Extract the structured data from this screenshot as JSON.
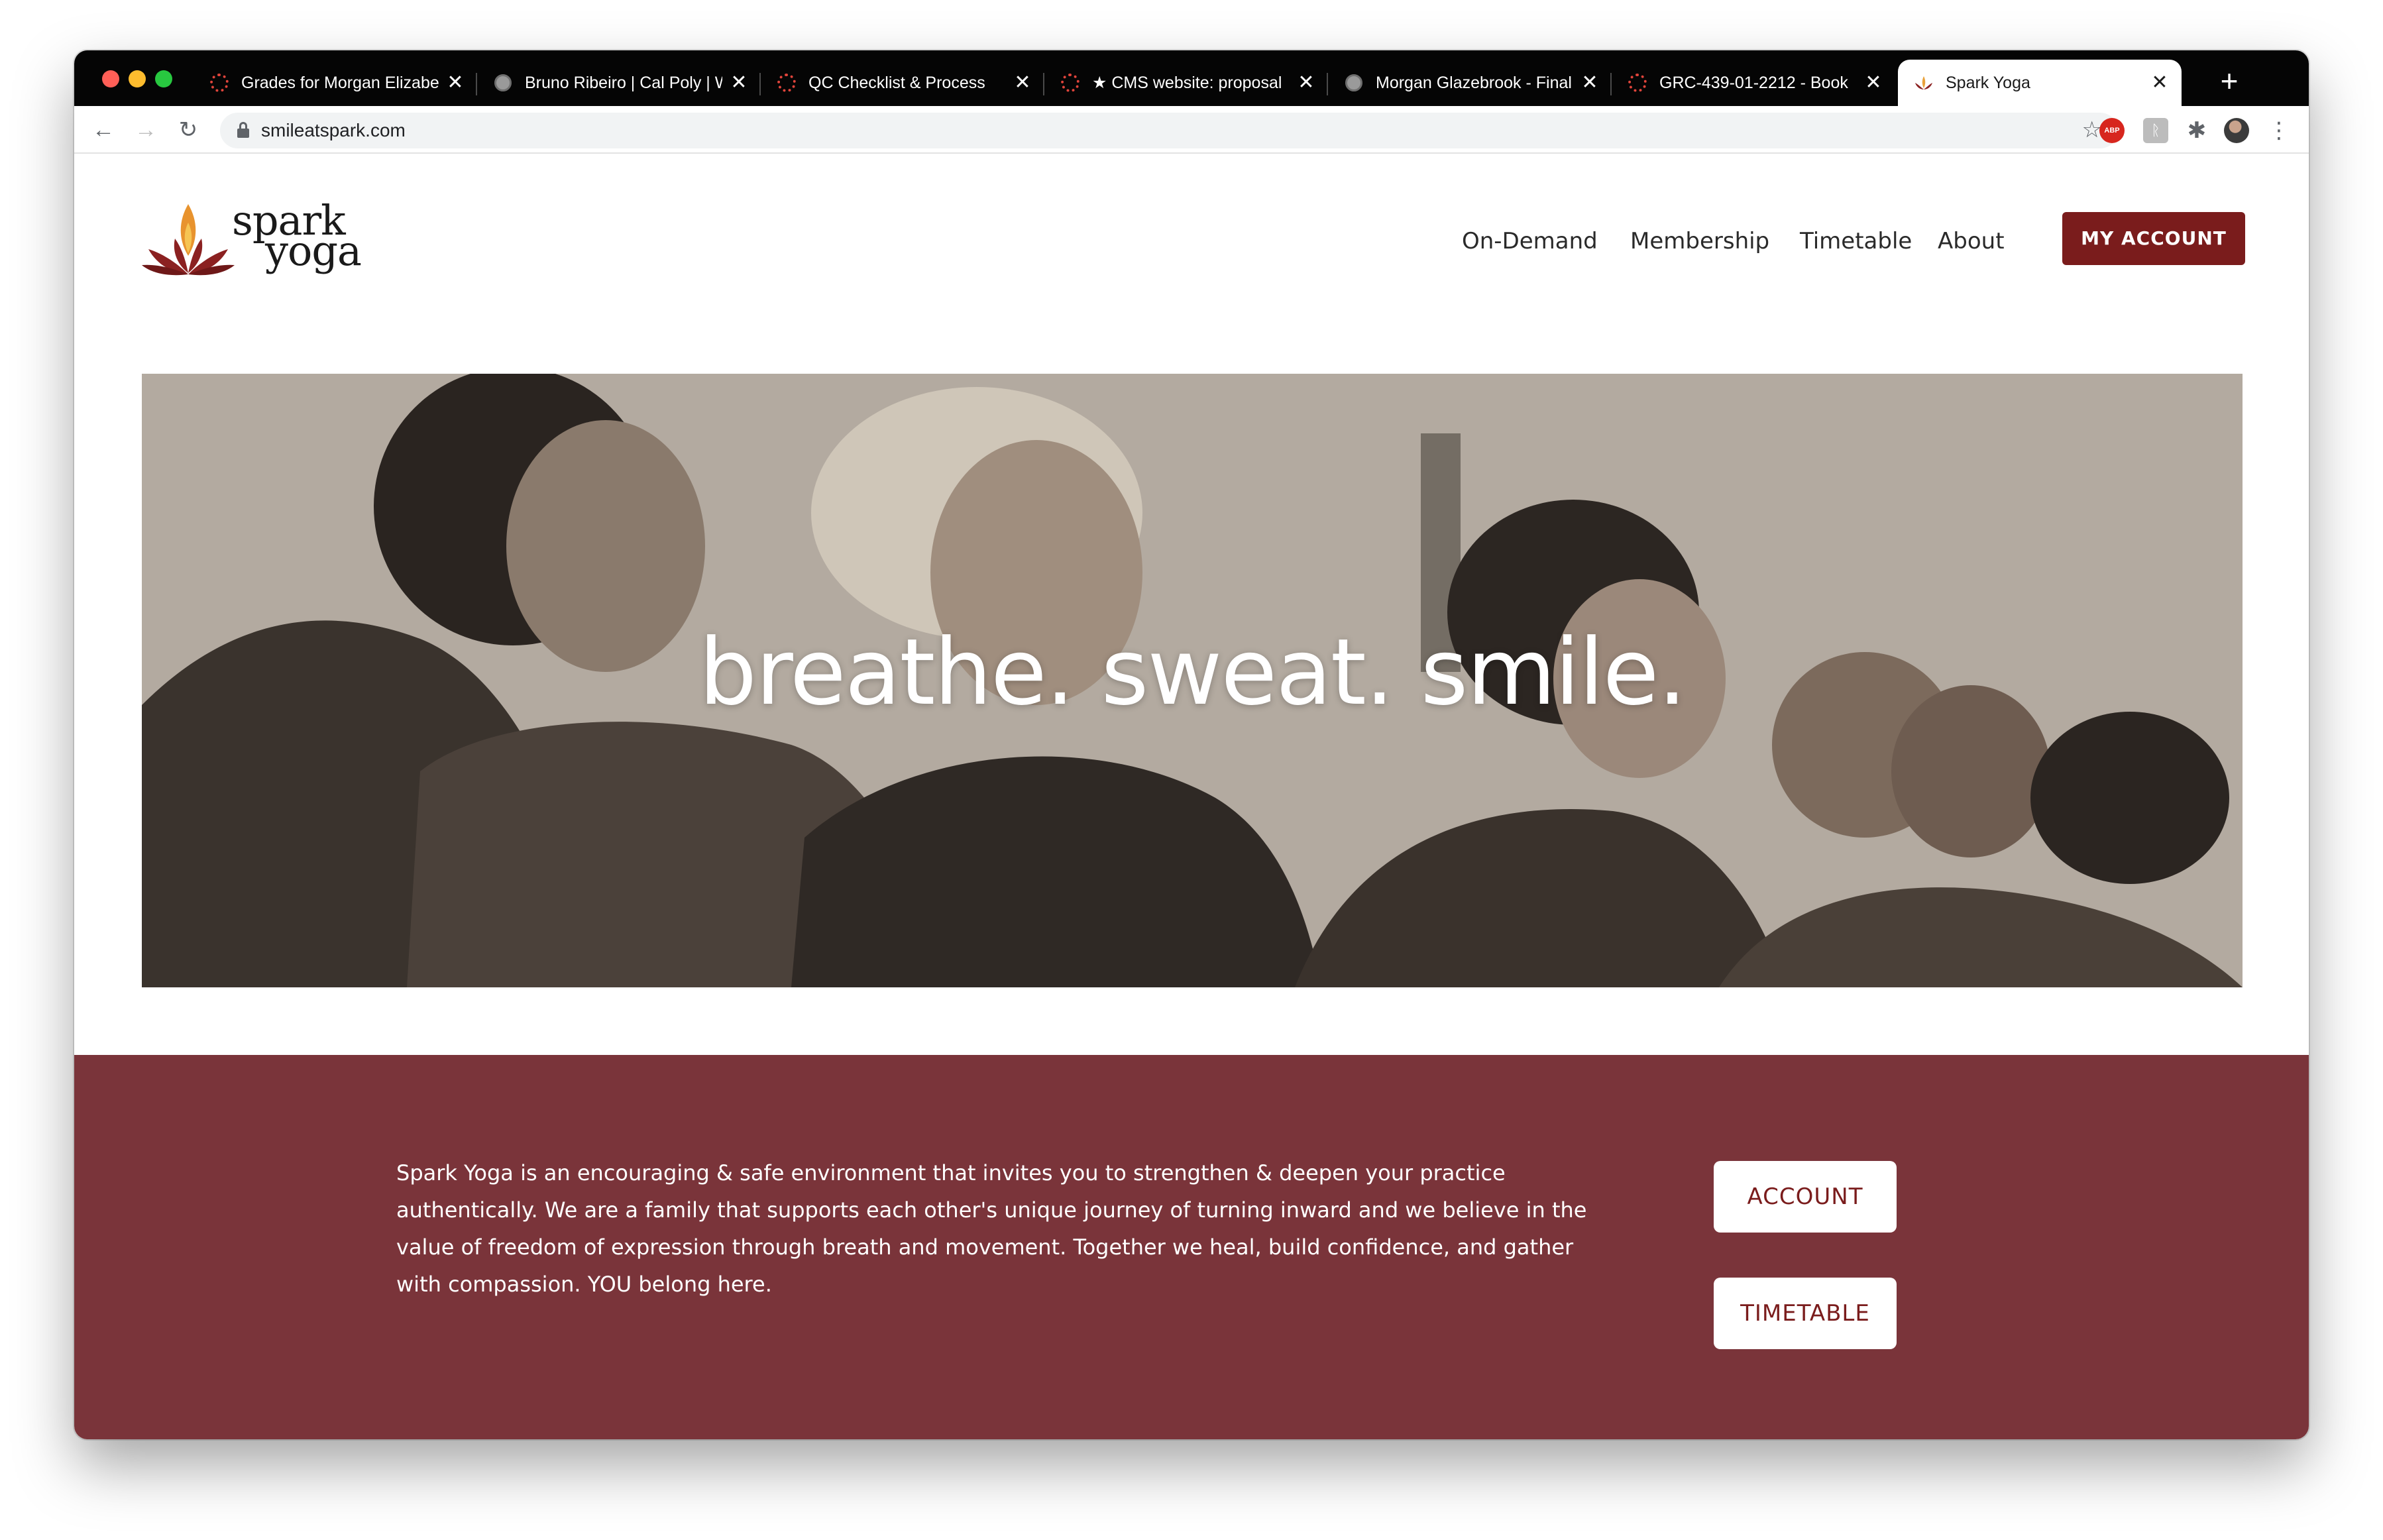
{
  "browser": {
    "tabs": [
      {
        "title": "Grades for Morgan Elizabe",
        "icon": "canvas-icon"
      },
      {
        "title": "Bruno Ribeiro | Cal Poly | W",
        "icon": "globe-icon"
      },
      {
        "title": "QC Checklist & Process",
        "icon": "canvas-icon"
      },
      {
        "title": "★ CMS website: proposal",
        "icon": "canvas-icon"
      },
      {
        "title": "Morgan Glazebrook - Final",
        "icon": "globe-icon"
      },
      {
        "title": "GRC-439-01-2212 - Book",
        "icon": "canvas-icon"
      },
      {
        "title": "Spark Yoga",
        "icon": "spark-lotus-icon",
        "active": true
      }
    ],
    "new_tab_label": "+",
    "close_glyph": "✕",
    "url": "smileatspark.com",
    "extensions": {
      "abp_label": "ABP",
      "ext2_label": "ᚱ"
    }
  },
  "site": {
    "logo": {
      "line1": "spark",
      "line2": "yoga"
    },
    "nav": {
      "on_demand": "On-Demand",
      "membership": "Membership",
      "timetable": "Timetable",
      "about": "About",
      "my_account": "MY ACCOUNT"
    },
    "hero": {
      "tagline": "breathe. sweat. smile."
    },
    "intro": {
      "text": "Spark Yoga is an encouraging & safe environment that invites you to strengthen & deepen your practice authentically. We are a family that supports each other's unique journey of turning inward and we believe in the value of freedom of expression through breath and movement. Together we heal, build confidence, and gather with compassion. YOU belong here.",
      "account_button": "ACCOUNT",
      "timetable_button": "TIMETABLE"
    }
  },
  "colors": {
    "brand_red": "#7a1c1c",
    "band_bg": "#7a343a",
    "tabstrip_bg": "#050505"
  }
}
